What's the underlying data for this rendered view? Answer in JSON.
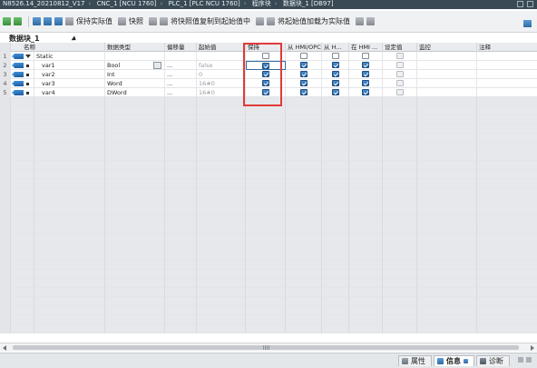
{
  "titlebar": {
    "crumbs": [
      "N8526.14_20210812_V17",
      "CNC_1 [NCU 1760]",
      "PLC_1 [PLC NCU 1760]",
      "程序块",
      "数据块_1 [DB97]"
    ]
  },
  "toolbar": {
    "keep_actual_label": "保持实际值",
    "snapshot_label": "快照",
    "copy_snapshot_label": "将快照值复制到起始值中",
    "load_start_label": "将起始值加载为实际值"
  },
  "block_title": "数据块_1",
  "columns": {
    "name": "名称",
    "datatype": "数据类型",
    "offset": "偏移量",
    "start": "起始值",
    "retain": "保持",
    "hmi_opc": "从 HMI/OPC...",
    "hmi_access": "从 H...",
    "hmi_visible": "在 HMI ...",
    "setpoint": "设定值",
    "monitor": "监控",
    "comment": "注释"
  },
  "rows": [
    {
      "num": "1",
      "name": "Static",
      "type": "",
      "offset": "",
      "start": "",
      "retain": false,
      "hmi_opc": false,
      "hmi_access": false,
      "hmi_visible": false,
      "setpoint": false
    },
    {
      "num": "2",
      "name": "var1",
      "type": "Bool",
      "offset": "...",
      "start": "false",
      "retain": true,
      "hmi_opc": true,
      "hmi_access": true,
      "hmi_visible": true,
      "setpoint": false
    },
    {
      "num": "3",
      "name": "var2",
      "type": "Int",
      "offset": "...",
      "start": "0",
      "retain": true,
      "hmi_opc": true,
      "hmi_access": true,
      "hmi_visible": true,
      "setpoint": false
    },
    {
      "num": "4",
      "name": "var3",
      "type": "Word",
      "offset": "...",
      "start": "16#0",
      "retain": true,
      "hmi_opc": true,
      "hmi_access": true,
      "hmi_visible": true,
      "setpoint": false
    },
    {
      "num": "5",
      "name": "var4",
      "type": "DWord",
      "offset": "...",
      "start": "16#0",
      "retain": true,
      "hmi_opc": true,
      "hmi_access": true,
      "hmi_visible": true,
      "setpoint": false
    }
  ],
  "bottom_tabs": {
    "properties": "属性",
    "info": "信息",
    "diagnostics": "诊断"
  },
  "colors": {
    "highlight_box": "#e03a3a",
    "accent": "#2f6aa3"
  },
  "icons": [
    "add-row-icon",
    "insert-row-icon",
    "variable-icon",
    "static-icon",
    "snapshot-icon",
    "copy-icon",
    "load-icon"
  ]
}
